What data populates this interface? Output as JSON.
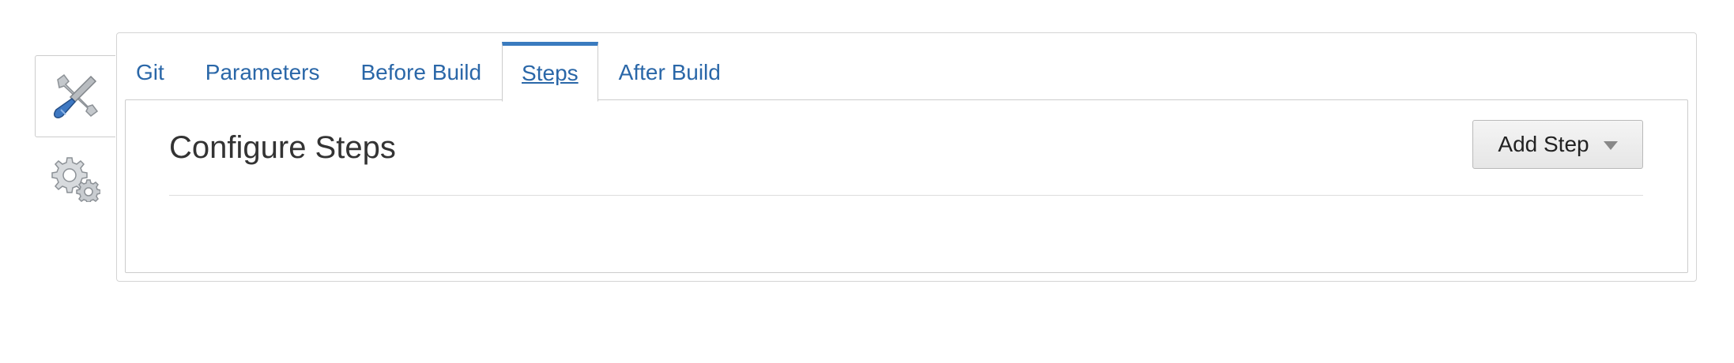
{
  "side_tabs": [
    {
      "icon": "tools-icon",
      "active": true
    },
    {
      "icon": "gears-icon",
      "active": false
    }
  ],
  "tabs": [
    {
      "label": "Git"
    },
    {
      "label": "Parameters"
    },
    {
      "label": "Before Build"
    },
    {
      "label": "Steps",
      "active": true
    },
    {
      "label": "After Build"
    }
  ],
  "section": {
    "title": "Configure Steps",
    "add_button_label": "Add Step"
  },
  "colors": {
    "link": "#2a67a8",
    "active_tab_border": "#3a7bbf",
    "panel_border": "#cccccc"
  }
}
